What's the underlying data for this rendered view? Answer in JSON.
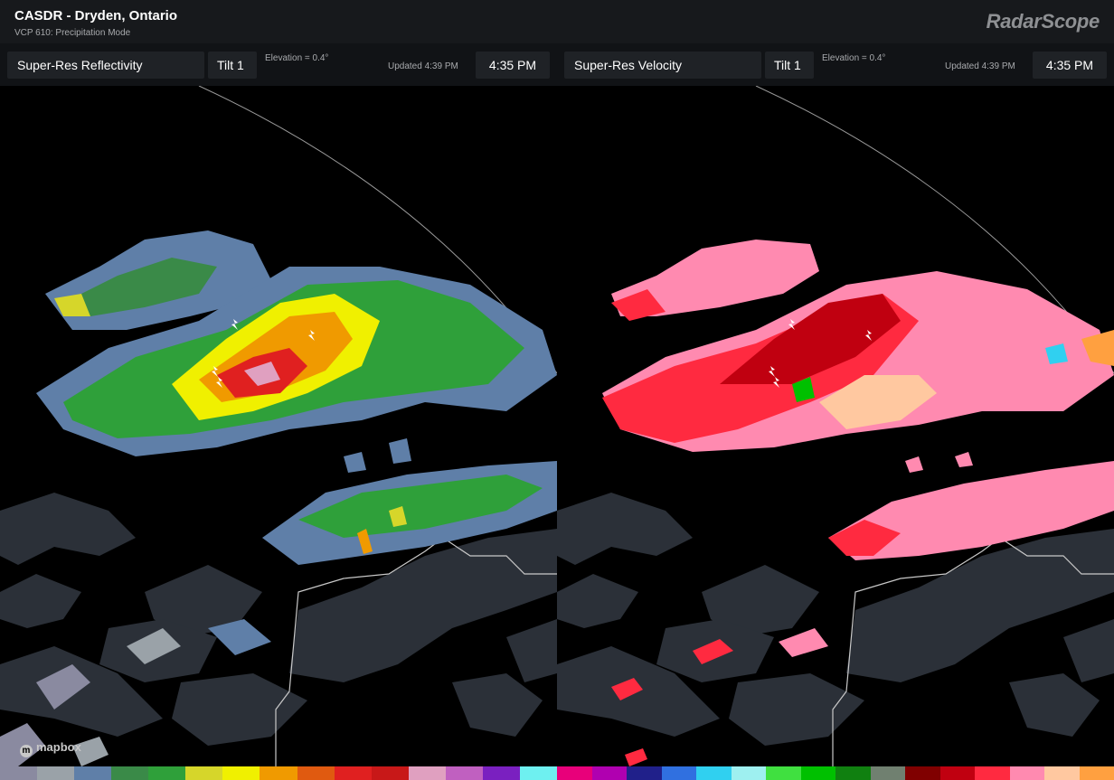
{
  "header": {
    "title": "CASDR - Dryden, Ontario",
    "subtitle": "VCP 610: Precipitation Mode",
    "logo": "RadarScope"
  },
  "panes": [
    {
      "product": "Super-Res Reflectivity",
      "tilt": "Tilt 1",
      "elevation": "Elevation = 0.4°",
      "updated": "Updated 4:39 PM",
      "time": "4:35 PM"
    },
    {
      "product": "Super-Res Velocity",
      "tilt": "Tilt 1",
      "elevation": "Elevation = 0.4°",
      "updated": "Updated 4:39 PM",
      "time": "4:35 PM"
    }
  ],
  "map": {
    "attribution": "mapbox",
    "land_color": "#2b3038",
    "boundary_color": "#c9c9c9"
  },
  "colors": {
    "reflectivity_palette": [
      "#8a8aa0",
      "#9aa2a8",
      "#5f7fa8",
      "#3a8a48",
      "#2fa03a",
      "#d6d62a",
      "#f0f000",
      "#f09a00",
      "#e05a10",
      "#e02020",
      "#c81818",
      "#e0a0c0",
      "#c060c0",
      "#7a20c0",
      "#6ef0f0"
    ],
    "velocity_palette": [
      "#e8007a",
      "#b000b0",
      "#20208a",
      "#3070e0",
      "#30d0f0",
      "#9ef0f0",
      "#40e040",
      "#00c000",
      "#108010",
      "#708070",
      "#800000",
      "#c00010",
      "#ff2a40",
      "#ff8ab0",
      "#ffc8a0",
      "#ffa040"
    ]
  },
  "icons": [
    "lightning-icon",
    "mapbox-logo-icon"
  ]
}
